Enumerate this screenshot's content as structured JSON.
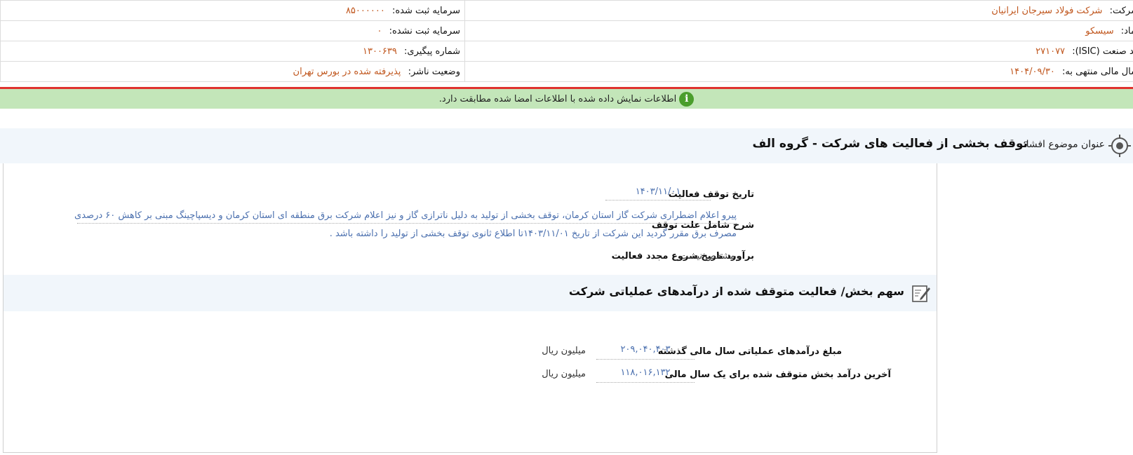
{
  "header": {
    "company_label": "شرکت:",
    "company_value": "شرکت فولاد سیرجان ایرانیان",
    "symbol_label": "نماد:",
    "symbol_value": "سیسکو",
    "isic_label": "کد صنعت (ISIC):",
    "isic_value": "۲۷۱۰۷۷",
    "fiscal_label": "سال مالی منتهی به:",
    "fiscal_value": "۱۴۰۴/۰۹/۳۰",
    "reg_capital_label": "سرمایه ثبت شده:",
    "reg_capital_value": "۸۵۰۰۰۰۰۰",
    "unreg_capital_label": "سرمایه ثبت نشده:",
    "unreg_capital_value": "۰",
    "tracking_label": "شماره پیگیری:",
    "tracking_value": "۱۳۰۰۶۳۹",
    "status_label": "وضعیت ناشر:",
    "status_value": "پذیرفته شده در بورس تهران"
  },
  "notice": {
    "text": "اطلاعات نمایش داده شده با اطلاعات امضا شده مطابقت دارد."
  },
  "subject": {
    "label": "عنوان موضوع افشا:",
    "title": "توقف بخشی از فعالیت های شرکت - گروه الف"
  },
  "details": {
    "stop_date_label": "تاریخ توقف فعالیت",
    "stop_date_value": "۱۴۰۳/۱۱/۰۱",
    "reason_label": "شرح شامل علت توقف",
    "reason_line1": "پیرو اعلام اضطراری شرکت گاز استان کرمان، توقف بخشی از تولید به دلیل ناترازی گاز و نیز اعلام شرکت برق منطقه ای استان کرمان و دیسپاچینگ مبنی بر کاهش ۶۰ درصدی",
    "reason_line2": "مصرف برق مقرر گردید این شرکت از تاریخ ۱۴۰۳/۱۱/۰۱تا اطلاع ثانوی توقف بخشی از تولید را داشته باشد .",
    "restart_label": "برآورد تاریخ شروع مجدد فعالیت",
    "restart_value": "مشخص نیست"
  },
  "share": {
    "title": "سهم بخش/ فعالیت متوقف شده از درآمدهای عملیاتی شرکت",
    "last_year_label": "مبلغ درآمدهای عملیاتی سال مالی گذشته",
    "last_year_value": "۲۰۹,۰۴۰,۴۰۳",
    "last_year_unit": "میلیون ریال",
    "stopped_label": "آخرین درآمد بخش متوقف شده برای یک سال مالی",
    "stopped_value": "۱۱۸,۰۱۶,۱۳۲",
    "stopped_unit": "میلیون ریال"
  },
  "icons": {
    "info": "info-icon",
    "target": "target-icon",
    "edit": "edit-document-icon"
  },
  "colors": {
    "value_orange": "#c0561d",
    "value_blue": "#4a6fae",
    "notice_green": "#c3e6b9",
    "red_line": "#e0332f"
  }
}
